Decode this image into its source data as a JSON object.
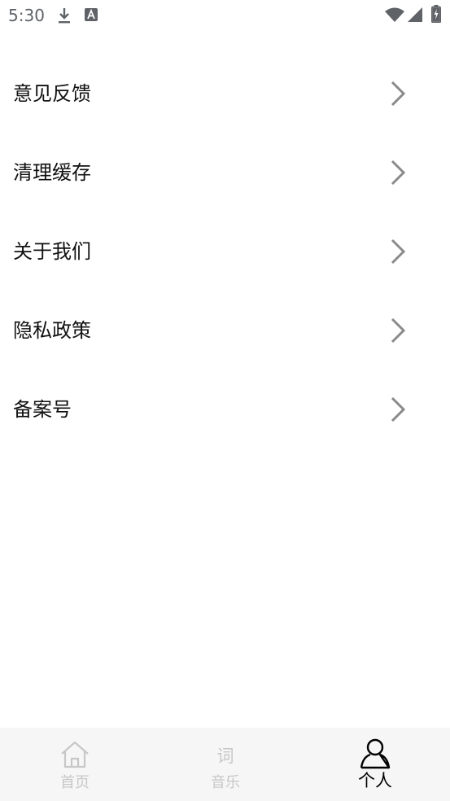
{
  "status_bar": {
    "time": "5:30",
    "icons": [
      "download-icon",
      "a-icon",
      "wifi-icon",
      "signal-icon",
      "battery-charging-icon"
    ]
  },
  "menu": {
    "items": [
      {
        "label": "意见反馈",
        "icon": "chevron-right-icon"
      },
      {
        "label": "清理缓存",
        "icon": "chevron-right-icon"
      },
      {
        "label": "关于我们",
        "icon": "chevron-right-icon"
      },
      {
        "label": "隐私政策",
        "icon": "chevron-right-icon"
      },
      {
        "label": "备案号",
        "icon": "chevron-right-icon"
      }
    ]
  },
  "tabbar": {
    "tabs": [
      {
        "label": "首页",
        "icon": "home-icon",
        "active": false
      },
      {
        "label": "音乐",
        "icon_text": "词",
        "active": false
      },
      {
        "label": "个人",
        "icon": "person-icon",
        "active": true
      }
    ]
  },
  "colors": {
    "background": "#ffffff",
    "tabbar_bg": "#f6f6f6",
    "inactive_tab": "#c7c7c7",
    "active_tab": "#000000",
    "chevron": "#8a8a8a"
  }
}
